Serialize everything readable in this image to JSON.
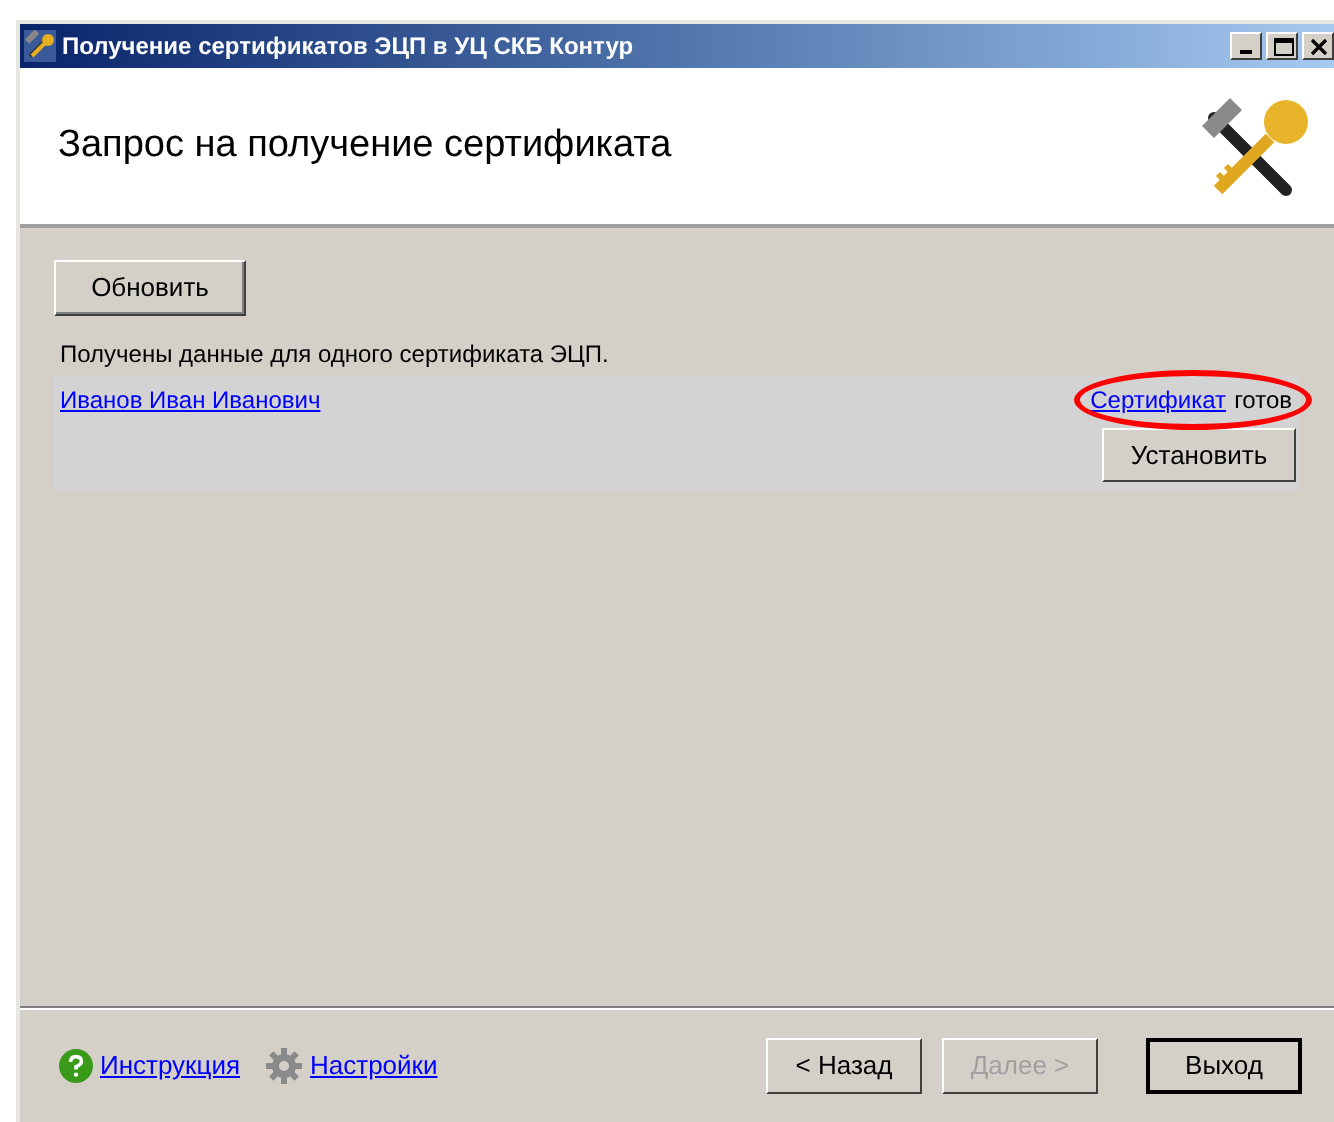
{
  "window": {
    "title": "Получение сертификатов ЭЦП в УЦ СКБ Контур"
  },
  "header": {
    "title": "Запрос на получение сертификата"
  },
  "refresh_button": {
    "label": "Обновить"
  },
  "status_text": "Получены данные для одного сертификата ЭЦП.",
  "certificates": [
    {
      "owner": "Иванов Иван Иванович",
      "status_link": "Сертификат",
      "status_text": "готов",
      "highlighted": true,
      "install_button": {
        "label": "Установить"
      }
    }
  ],
  "footer": {
    "links": [
      {
        "kind": "help",
        "label": "Инструкция"
      },
      {
        "kind": "settings",
        "label": "Настройки"
      }
    ],
    "buttons": [
      {
        "label": "< Назад",
        "disabled": false,
        "default": false
      },
      {
        "label": "Далее >",
        "disabled": true,
        "default": false
      },
      {
        "label": "Выход",
        "disabled": false,
        "default": true
      }
    ]
  }
}
